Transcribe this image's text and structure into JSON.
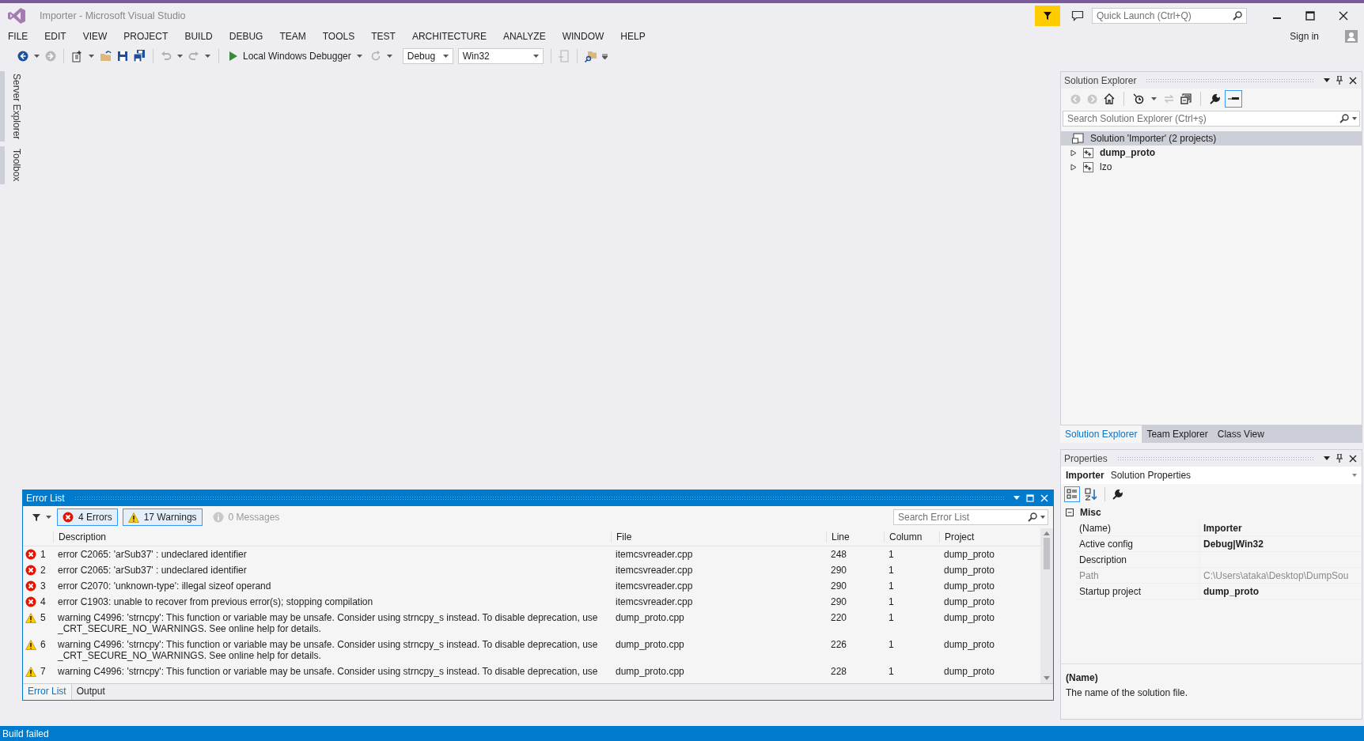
{
  "window": {
    "title": "Importer - Microsoft Visual Studio",
    "quick_launch": {
      "placeholder": "Quick Launch (Ctrl+Q)"
    },
    "sign_in": "Sign in"
  },
  "menu": [
    "FILE",
    "EDIT",
    "VIEW",
    "PROJECT",
    "BUILD",
    "DEBUG",
    "TEAM",
    "TOOLS",
    "TEST",
    "ARCHITECTURE",
    "ANALYZE",
    "WINDOW",
    "HELP"
  ],
  "toolbar": {
    "debugger": "Local Windows Debugger",
    "configuration": "Debug",
    "platform": "Win32"
  },
  "side_tabs": [
    "Server Explorer",
    "Toolbox"
  ],
  "error_list": {
    "title": "Error List",
    "search": {
      "placeholder": "Search Error List"
    },
    "filters": [
      {
        "kind": "error",
        "label": "4 Errors",
        "selected": true
      },
      {
        "kind": "warning",
        "label": "17 Warnings",
        "selected": true
      },
      {
        "kind": "message",
        "label": "0 Messages",
        "selected": false
      }
    ],
    "columns": [
      "Description",
      "File",
      "Line",
      "Column",
      "Project"
    ],
    "rows": [
      {
        "kind": "error",
        "number": "1",
        "description": "error C2065: 'arSub37' : undeclared identifier",
        "file": "itemcsvreader.cpp",
        "line": "248",
        "column": "1",
        "project": "dump_proto"
      },
      {
        "kind": "error",
        "number": "2",
        "description": "error C2065: 'arSub37' : undeclared identifier",
        "file": "itemcsvreader.cpp",
        "line": "290",
        "column": "1",
        "project": "dump_proto"
      },
      {
        "kind": "error",
        "number": "3",
        "description": "error C2070: 'unknown-type': illegal sizeof operand",
        "file": "itemcsvreader.cpp",
        "line": "290",
        "column": "1",
        "project": "dump_proto"
      },
      {
        "kind": "error",
        "number": "4",
        "description": "error C1903: unable to recover from previous error(s); stopping compilation",
        "file": "itemcsvreader.cpp",
        "line": "290",
        "column": "1",
        "project": "dump_proto"
      },
      {
        "kind": "warning",
        "number": "5",
        "description": "warning C4996: 'strncpy': This function or variable may be unsafe. Consider using strncpy_s instead. To disable deprecation, use _CRT_SECURE_NO_WARNINGS. See online help for details.",
        "file": "dump_proto.cpp",
        "line": "220",
        "column": "1",
        "project": "dump_proto"
      },
      {
        "kind": "warning",
        "number": "6",
        "description": "warning C4996: 'strncpy': This function or variable may be unsafe. Consider using strncpy_s instead. To disable deprecation, use _CRT_SECURE_NO_WARNINGS. See online help for details.",
        "file": "dump_proto.cpp",
        "line": "226",
        "column": "1",
        "project": "dump_proto"
      },
      {
        "kind": "warning",
        "number": "7",
        "description": "warning C4996: 'strncpy': This function or variable may be unsafe. Consider using strncpy_s instead. To disable deprecation, use",
        "file": "dump_proto.cpp",
        "line": "228",
        "column": "1",
        "project": "dump_proto"
      }
    ],
    "tabs": [
      {
        "label": "Error List",
        "selected": true
      },
      {
        "label": "Output",
        "selected": false
      }
    ]
  },
  "solution_explorer": {
    "title": "Solution Explorer",
    "search": {
      "placeholder": "Search Solution Explorer (Ctrl+ş)"
    },
    "tree": [
      {
        "label": "Solution 'Importer' (2 projects)",
        "selected": true,
        "children": [
          {
            "label": "dump_proto",
            "startup": true,
            "expanded": false
          },
          {
            "label": "lzo",
            "startup": false,
            "expanded": false
          }
        ]
      }
    ],
    "tabs": [
      {
        "label": "Solution Explorer",
        "selected": true
      },
      {
        "label": "Team Explorer",
        "selected": false
      },
      {
        "label": "Class View",
        "selected": false
      }
    ]
  },
  "properties": {
    "title": "Properties",
    "object": "Importer",
    "object_type": "Solution Properties",
    "category": "Misc",
    "expanded": true,
    "rows": [
      {
        "name": "(Name)",
        "value": "Importer",
        "disabled": false
      },
      {
        "name": "Active config",
        "value": "Debug|Win32",
        "disabled": false
      },
      {
        "name": "Description",
        "value": "",
        "disabled": false
      },
      {
        "name": "Path",
        "value": "C:\\Users\\ataka\\Desktop\\DumpSou",
        "disabled": true
      },
      {
        "name": "Startup project",
        "value": "dump_proto",
        "disabled": false
      }
    ],
    "help_title": "(Name)",
    "help_text": "The name of the solution file."
  },
  "status_bar": {
    "text": "Build failed"
  }
}
